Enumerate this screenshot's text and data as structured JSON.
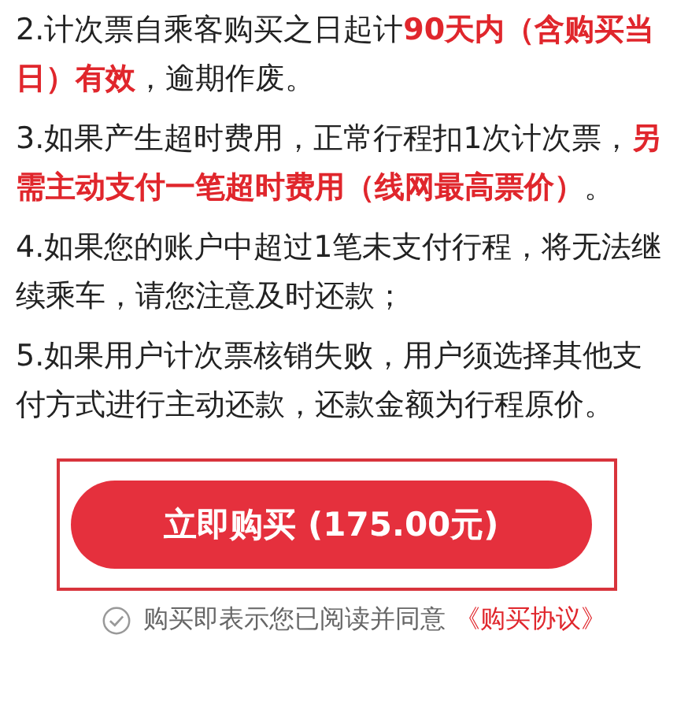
{
  "rules": [
    "2.计次票自乘客购买之日起计**90天内（含购买当日）有效**，逾期作废。",
    "3.如果产生超时费用，正常行程扣1次计次票，**另需主动支付一笔超时费用（线网最高票价）**。",
    "4.如果您的账户中超过1笔未支付行程，将无法继续乘车，请您注意及时还款；",
    "5.如果用户计次票核销失败，用户须选择其他支付方式进行主动还款，还款金额为行程原价。"
  ],
  "buy_button": {
    "label": "立即购买 (175.00元)"
  },
  "agreement": {
    "checked": false,
    "text": "购买即表示您已阅读并同意",
    "link": "《购买协议》"
  }
}
